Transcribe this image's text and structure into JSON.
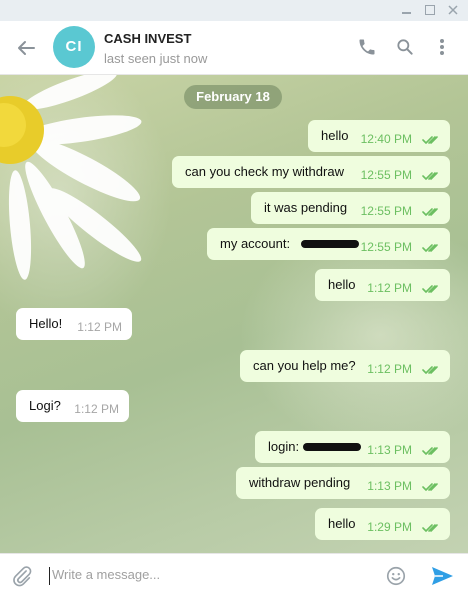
{
  "window": {
    "minimize": "—",
    "maximize": "☐",
    "close": "✕"
  },
  "header": {
    "avatar_initials": "CI",
    "avatar_color": "#5ac8d2",
    "name": "CASH INVEST",
    "status": "last seen just now",
    "icons": [
      "back-arrow-icon",
      "phone-icon",
      "search-icon",
      "more-vertical-icon"
    ]
  },
  "chat": {
    "date_label": "February 18",
    "messages": [
      {
        "dir": "out",
        "text": "hello",
        "time": "12:40 PM",
        "ticks": "double-check"
      },
      {
        "dir": "out",
        "text": "can you check my withdraw",
        "time": "12:55 PM",
        "ticks": "double-check"
      },
      {
        "dir": "out",
        "text": "it was pending",
        "time": "12:55 PM",
        "ticks": "double-check"
      },
      {
        "dir": "out",
        "text": "my account:",
        "redacted": true,
        "time": "12:55 PM",
        "ticks": "double-check"
      },
      {
        "dir": "out",
        "text": "hello",
        "time": "1:12 PM",
        "ticks": "double-check"
      },
      {
        "dir": "in",
        "text": "Hello!",
        "time": "1:12 PM"
      },
      {
        "dir": "out",
        "text": "can you help me?",
        "time": "1:12 PM",
        "ticks": "double-check"
      },
      {
        "dir": "in",
        "text": "Logi?",
        "time": "1:12 PM"
      },
      {
        "dir": "out",
        "text": "login:",
        "redacted": true,
        "time": "1:13 PM",
        "ticks": "double-check"
      },
      {
        "dir": "out",
        "text": "withdraw pending",
        "time": "1:13 PM",
        "ticks": "double-check"
      },
      {
        "dir": "out",
        "text": "hello",
        "time": "1:29 PM",
        "ticks": "double-check"
      }
    ]
  },
  "composer": {
    "placeholder": "Write a message...",
    "icons": [
      "attach-icon",
      "emoji-icon",
      "send-icon"
    ]
  },
  "colors": {
    "outgoing_bubble": "#effdde",
    "incoming_bubble": "#ffffff",
    "tick": "#6cbf61",
    "send": "#2f9ee5"
  }
}
